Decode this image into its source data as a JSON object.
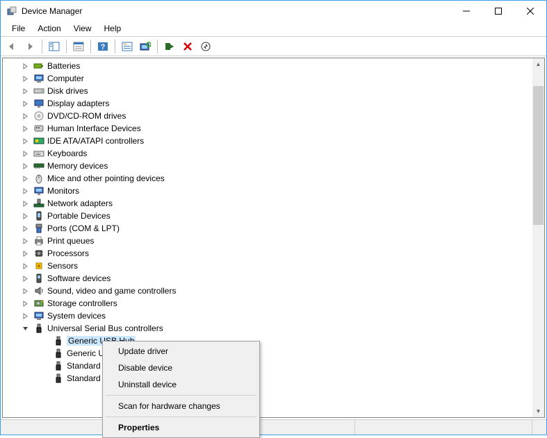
{
  "window": {
    "title": "Device Manager"
  },
  "menubar": {
    "items": [
      "File",
      "Action",
      "View",
      "Help"
    ]
  },
  "tree": {
    "items": [
      {
        "label": "Batteries",
        "icon": "battery-icon"
      },
      {
        "label": "Computer",
        "icon": "computer-icon"
      },
      {
        "label": "Disk drives",
        "icon": "disk-icon"
      },
      {
        "label": "Display adapters",
        "icon": "display-icon"
      },
      {
        "label": "DVD/CD-ROM drives",
        "icon": "dvd-icon"
      },
      {
        "label": "Human Interface Devices",
        "icon": "hid-icon"
      },
      {
        "label": "IDE ATA/ATAPI controllers",
        "icon": "ide-icon"
      },
      {
        "label": "Keyboards",
        "icon": "keyboard-icon"
      },
      {
        "label": "Memory devices",
        "icon": "memory-icon"
      },
      {
        "label": "Mice and other pointing devices",
        "icon": "mouse-icon"
      },
      {
        "label": "Monitors",
        "icon": "monitor-icon"
      },
      {
        "label": "Network adapters",
        "icon": "network-icon"
      },
      {
        "label": "Portable Devices",
        "icon": "portable-icon"
      },
      {
        "label": "Ports (COM & LPT)",
        "icon": "ports-icon"
      },
      {
        "label": "Print queues",
        "icon": "printer-icon"
      },
      {
        "label": "Processors",
        "icon": "cpu-icon"
      },
      {
        "label": "Sensors",
        "icon": "sensor-icon"
      },
      {
        "label": "Software devices",
        "icon": "software-icon"
      },
      {
        "label": "Sound, video and game controllers",
        "icon": "sound-icon"
      },
      {
        "label": "Storage controllers",
        "icon": "storage-icon"
      },
      {
        "label": "System devices",
        "icon": "system-icon"
      }
    ],
    "expanded_category": {
      "label": "Universal Serial Bus controllers",
      "icon": "usb-icon",
      "children": [
        {
          "label": "Generic USB Hub",
          "icon": "usb-device-icon",
          "selected": true
        },
        {
          "label": "Generic U",
          "icon": "usb-device-icon"
        },
        {
          "label": "Standard",
          "icon": "usb-device-icon"
        },
        {
          "label": "Standard",
          "icon": "usb-device-icon"
        }
      ]
    }
  },
  "context_menu": {
    "items": [
      {
        "label": "Update driver",
        "kind": "item"
      },
      {
        "label": "Disable device",
        "kind": "item"
      },
      {
        "label": "Uninstall device",
        "kind": "item"
      },
      {
        "kind": "sep"
      },
      {
        "label": "Scan for hardware changes",
        "kind": "item"
      },
      {
        "kind": "sep"
      },
      {
        "label": "Properties",
        "kind": "item",
        "bold": true
      }
    ]
  }
}
